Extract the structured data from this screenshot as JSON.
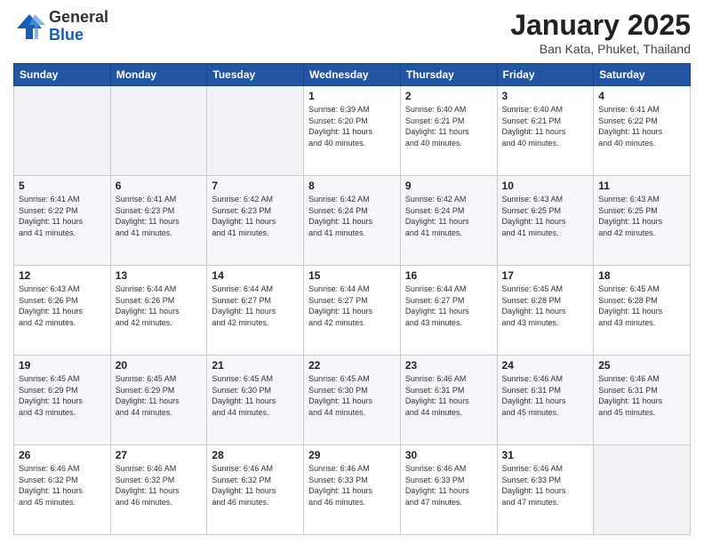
{
  "header": {
    "logo_general": "General",
    "logo_blue": "Blue",
    "month_title": "January 2025",
    "location": "Ban Kata, Phuket, Thailand"
  },
  "days_of_week": [
    "Sunday",
    "Monday",
    "Tuesday",
    "Wednesday",
    "Thursday",
    "Friday",
    "Saturday"
  ],
  "weeks": [
    [
      {
        "day": "",
        "info": ""
      },
      {
        "day": "",
        "info": ""
      },
      {
        "day": "",
        "info": ""
      },
      {
        "day": "1",
        "info": "Sunrise: 6:39 AM\nSunset: 6:20 PM\nDaylight: 11 hours\nand 40 minutes."
      },
      {
        "day": "2",
        "info": "Sunrise: 6:40 AM\nSunset: 6:21 PM\nDaylight: 11 hours\nand 40 minutes."
      },
      {
        "day": "3",
        "info": "Sunrise: 6:40 AM\nSunset: 6:21 PM\nDaylight: 11 hours\nand 40 minutes."
      },
      {
        "day": "4",
        "info": "Sunrise: 6:41 AM\nSunset: 6:22 PM\nDaylight: 11 hours\nand 40 minutes."
      }
    ],
    [
      {
        "day": "5",
        "info": "Sunrise: 6:41 AM\nSunset: 6:22 PM\nDaylight: 11 hours\nand 41 minutes."
      },
      {
        "day": "6",
        "info": "Sunrise: 6:41 AM\nSunset: 6:23 PM\nDaylight: 11 hours\nand 41 minutes."
      },
      {
        "day": "7",
        "info": "Sunrise: 6:42 AM\nSunset: 6:23 PM\nDaylight: 11 hours\nand 41 minutes."
      },
      {
        "day": "8",
        "info": "Sunrise: 6:42 AM\nSunset: 6:24 PM\nDaylight: 11 hours\nand 41 minutes."
      },
      {
        "day": "9",
        "info": "Sunrise: 6:42 AM\nSunset: 6:24 PM\nDaylight: 11 hours\nand 41 minutes."
      },
      {
        "day": "10",
        "info": "Sunrise: 6:43 AM\nSunset: 6:25 PM\nDaylight: 11 hours\nand 41 minutes."
      },
      {
        "day": "11",
        "info": "Sunrise: 6:43 AM\nSunset: 6:25 PM\nDaylight: 11 hours\nand 42 minutes."
      }
    ],
    [
      {
        "day": "12",
        "info": "Sunrise: 6:43 AM\nSunset: 6:26 PM\nDaylight: 11 hours\nand 42 minutes."
      },
      {
        "day": "13",
        "info": "Sunrise: 6:44 AM\nSunset: 6:26 PM\nDaylight: 11 hours\nand 42 minutes."
      },
      {
        "day": "14",
        "info": "Sunrise: 6:44 AM\nSunset: 6:27 PM\nDaylight: 11 hours\nand 42 minutes."
      },
      {
        "day": "15",
        "info": "Sunrise: 6:44 AM\nSunset: 6:27 PM\nDaylight: 11 hours\nand 42 minutes."
      },
      {
        "day": "16",
        "info": "Sunrise: 6:44 AM\nSunset: 6:27 PM\nDaylight: 11 hours\nand 43 minutes."
      },
      {
        "day": "17",
        "info": "Sunrise: 6:45 AM\nSunset: 6:28 PM\nDaylight: 11 hours\nand 43 minutes."
      },
      {
        "day": "18",
        "info": "Sunrise: 6:45 AM\nSunset: 6:28 PM\nDaylight: 11 hours\nand 43 minutes."
      }
    ],
    [
      {
        "day": "19",
        "info": "Sunrise: 6:45 AM\nSunset: 6:29 PM\nDaylight: 11 hours\nand 43 minutes."
      },
      {
        "day": "20",
        "info": "Sunrise: 6:45 AM\nSunset: 6:29 PM\nDaylight: 11 hours\nand 44 minutes."
      },
      {
        "day": "21",
        "info": "Sunrise: 6:45 AM\nSunset: 6:30 PM\nDaylight: 11 hours\nand 44 minutes."
      },
      {
        "day": "22",
        "info": "Sunrise: 6:45 AM\nSunset: 6:30 PM\nDaylight: 11 hours\nand 44 minutes."
      },
      {
        "day": "23",
        "info": "Sunrise: 6:46 AM\nSunset: 6:31 PM\nDaylight: 11 hours\nand 44 minutes."
      },
      {
        "day": "24",
        "info": "Sunrise: 6:46 AM\nSunset: 6:31 PM\nDaylight: 11 hours\nand 45 minutes."
      },
      {
        "day": "25",
        "info": "Sunrise: 6:46 AM\nSunset: 6:31 PM\nDaylight: 11 hours\nand 45 minutes."
      }
    ],
    [
      {
        "day": "26",
        "info": "Sunrise: 6:46 AM\nSunset: 6:32 PM\nDaylight: 11 hours\nand 45 minutes."
      },
      {
        "day": "27",
        "info": "Sunrise: 6:46 AM\nSunset: 6:32 PM\nDaylight: 11 hours\nand 46 minutes."
      },
      {
        "day": "28",
        "info": "Sunrise: 6:46 AM\nSunset: 6:32 PM\nDaylight: 11 hours\nand 46 minutes."
      },
      {
        "day": "29",
        "info": "Sunrise: 6:46 AM\nSunset: 6:33 PM\nDaylight: 11 hours\nand 46 minutes."
      },
      {
        "day": "30",
        "info": "Sunrise: 6:46 AM\nSunset: 6:33 PM\nDaylight: 11 hours\nand 47 minutes."
      },
      {
        "day": "31",
        "info": "Sunrise: 6:46 AM\nSunset: 6:33 PM\nDaylight: 11 hours\nand 47 minutes."
      },
      {
        "day": "",
        "info": ""
      }
    ]
  ]
}
